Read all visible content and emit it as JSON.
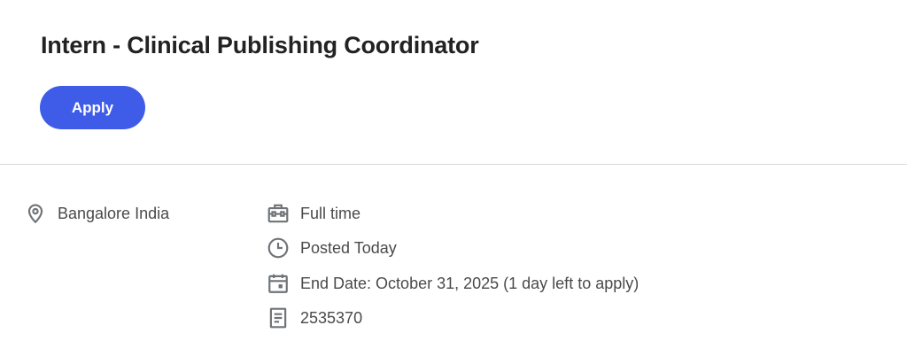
{
  "job": {
    "title": "Intern - Clinical Publishing Coordinator",
    "apply_label": "Apply"
  },
  "details": {
    "location": "Bangalore India",
    "employment_type": "Full time",
    "posted": "Posted Today",
    "end_date": "End Date: October 31, 2025 (1 day left to apply)",
    "requisition_id": "2535370"
  },
  "icons": {
    "location": "location-pin-icon",
    "employment_type": "briefcase-icon",
    "posted": "clock-icon",
    "end_date": "calendar-icon",
    "requisition_id": "document-icon"
  },
  "colors": {
    "accent": "#3f5ce8",
    "icon": "#6f7377"
  }
}
